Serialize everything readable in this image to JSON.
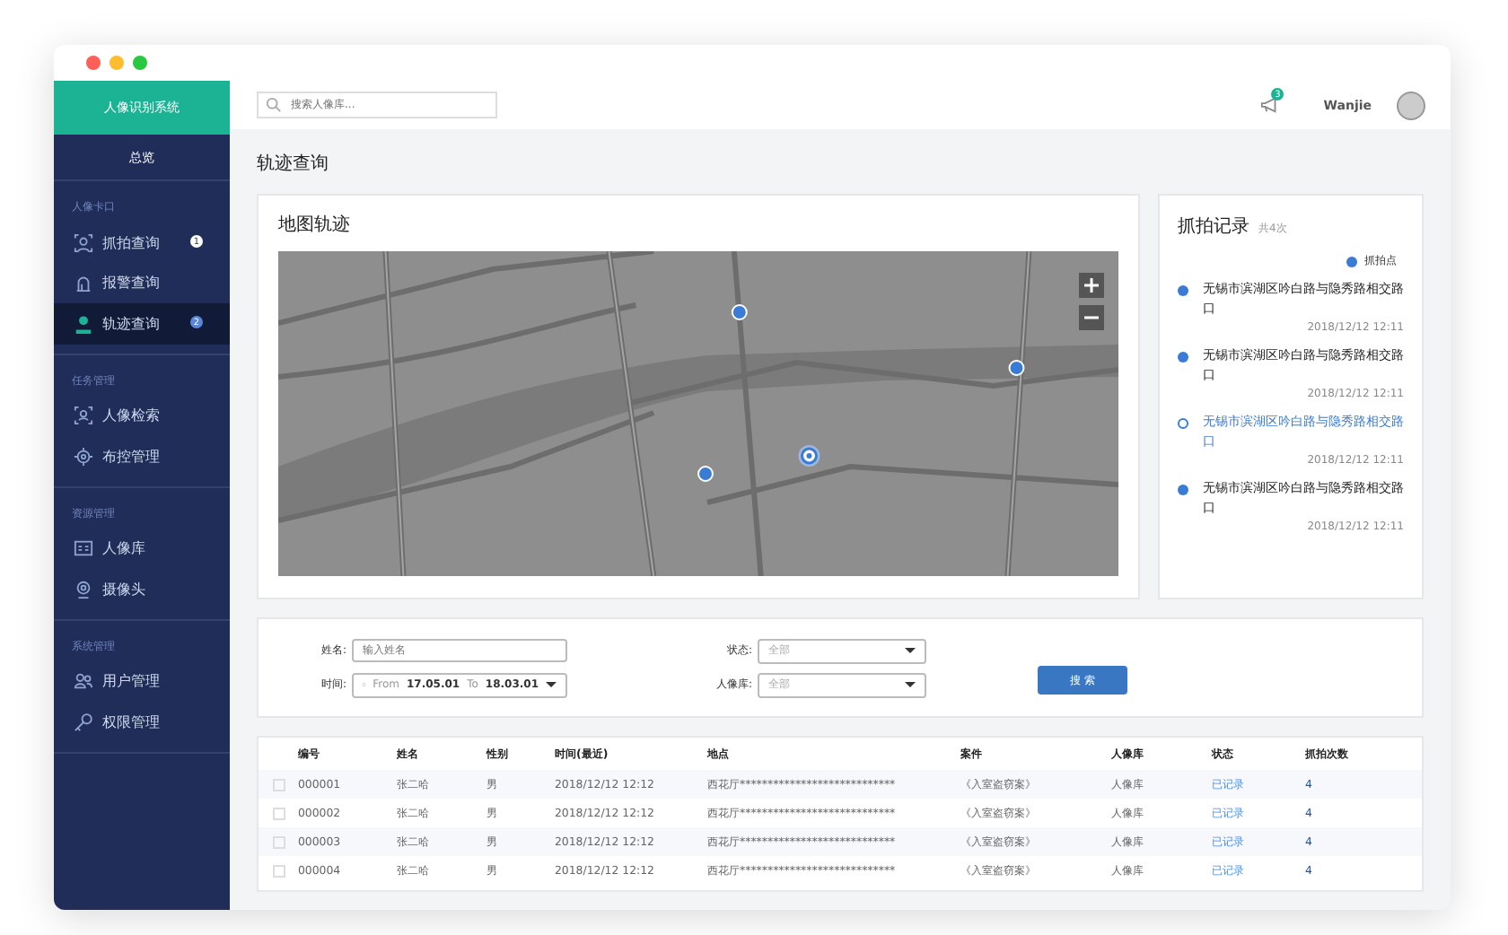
{
  "sidebar": {
    "title": "人像识别系统",
    "overview": "总览",
    "sections": [
      {
        "heading": "人像卡口",
        "items": [
          {
            "label": "抓拍查询",
            "badge": "1",
            "selected": false
          },
          {
            "label": "报警查询",
            "selected": false
          },
          {
            "label": "轨迹查询",
            "badge": "2",
            "selected": true
          }
        ]
      },
      {
        "heading": "任务管理",
        "items": [
          {
            "label": "人像检索",
            "selected": false
          },
          {
            "label": "布控管理",
            "selected": false
          }
        ]
      },
      {
        "heading": "资源管理",
        "items": [
          {
            "label": "人像库",
            "selected": false
          },
          {
            "label": "摄像头",
            "selected": false
          }
        ]
      },
      {
        "heading": "系统管理",
        "items": [
          {
            "label": "用户管理",
            "selected": false
          },
          {
            "label": "权限管理",
            "selected": false
          }
        ]
      }
    ]
  },
  "topbar": {
    "search": {
      "placeholder": "搜索人像库..."
    },
    "notification_badge": "3",
    "user": "Wanjie"
  },
  "page_title": "轨迹查询",
  "map_card": {
    "title": "地图轨迹"
  },
  "records": {
    "title": "抓拍记录",
    "count": "共4次",
    "legend": "抓拍点",
    "items": [
      {
        "place": "无锡市滨湖区吟白路与隐秀路相交路口",
        "time": "2018/12/12 12:11",
        "selected": false
      },
      {
        "place": "无锡市滨湖区吟白路与隐秀路相交路口",
        "time": "2018/12/12 12:11",
        "selected": false
      },
      {
        "place": "无锡市滨湖区吟白路与隐秀路相交路口",
        "time": "2018/12/12 12:11",
        "selected": true
      },
      {
        "place": "无锡市滨湖区吟白路与隐秀路相交路口",
        "time": "2018/12/12 12:11",
        "selected": false
      }
    ]
  },
  "filters": {
    "name": {
      "label": "姓名:",
      "placeholder": "输入姓名"
    },
    "status": {
      "label": "状态:",
      "value": "全部"
    },
    "time": {
      "label": "时间:",
      "from_label": "From",
      "from": "17.05.01",
      "to_label": "To",
      "to": "18.03.01"
    },
    "library": {
      "label": "人像库:",
      "value": "全部"
    },
    "search_button": "搜 索"
  },
  "table": {
    "columns": [
      "编号",
      "姓名",
      "性别",
      "时间(最近)",
      "地点",
      "案件",
      "人像库",
      "状态",
      "抓拍次数"
    ],
    "rows": [
      {
        "checked": false,
        "cells": [
          "000001",
          "张二哈",
          "男",
          "2018/12/12 12:12",
          "西花厅****************************",
          "《入室盗窃案》",
          "人像库",
          "已记录",
          "4"
        ]
      },
      {
        "checked": false,
        "cells": [
          "000002",
          "张二哈",
          "男",
          "2018/12/12 12:12",
          "西花厅****************************",
          "《入室盗窃案》",
          "人像库",
          "已记录",
          "4"
        ]
      },
      {
        "checked": false,
        "cells": [
          "000003",
          "张二哈",
          "男",
          "2018/12/12 12:12",
          "西花厅****************************",
          "《入室盗窃案》",
          "人像库",
          "已记录",
          "4"
        ]
      },
      {
        "checked": false,
        "cells": [
          "000004",
          "张二哈",
          "男",
          "2018/12/12 12:12",
          "西花厅****************************",
          "《入室盗窃案》",
          "人像库",
          "已记录",
          "4"
        ]
      }
    ]
  }
}
